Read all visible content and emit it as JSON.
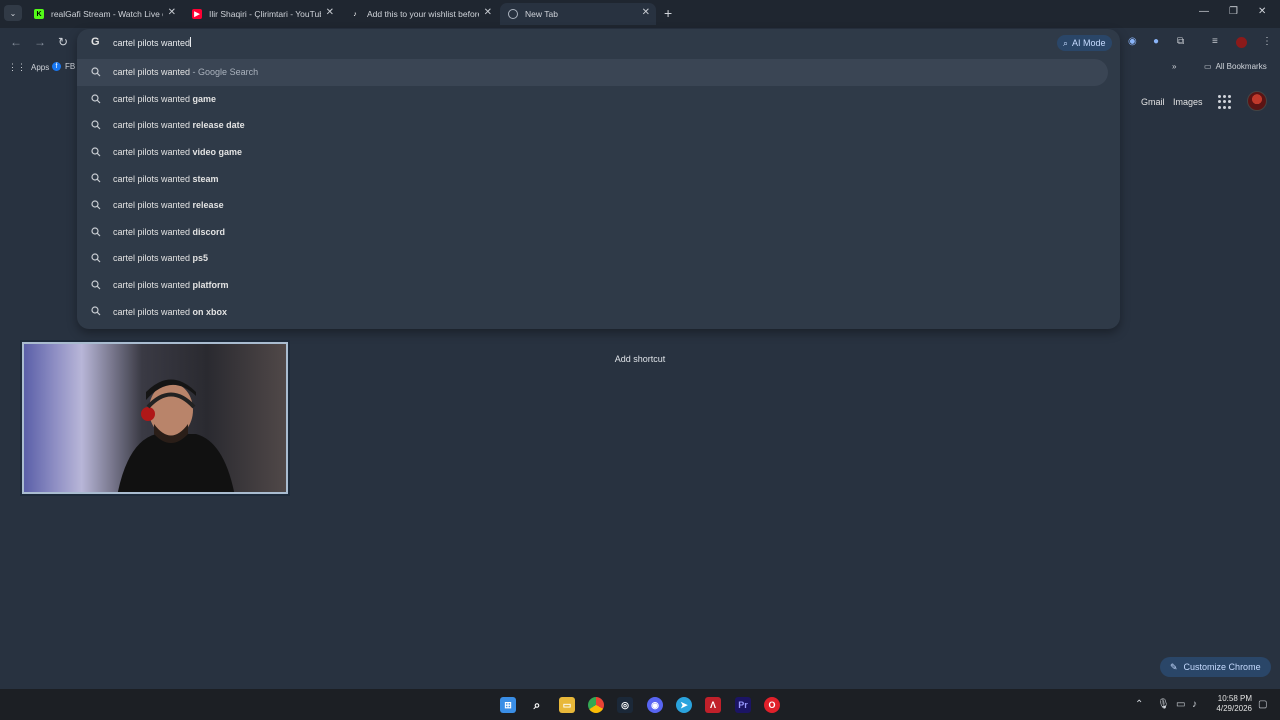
{
  "tabs": [
    {
      "title": "realGafi Stream - Watch Live on",
      "favicon": "kick-icon",
      "color": "#53fc18"
    },
    {
      "title": "Ilir Shaqiri - Çlirimtari - YouTube",
      "favicon": "youtube-icon",
      "color": "#ff0033"
    },
    {
      "title": "Add this to your wishlist before",
      "favicon": "tiktok-icon",
      "color": "#ffffff"
    },
    {
      "title": "New Tab",
      "favicon": "chrome-icon",
      "color": "#aab2bd"
    }
  ],
  "omnibox": {
    "query": "cartel pilots wanted",
    "ai_mode_label": "AI Mode",
    "suggestions": [
      {
        "base": "cartel pilots wanted",
        "suffix": " - Google Search",
        "bold": false
      },
      {
        "base": "cartel pilots wanted ",
        "suffix": "game",
        "bold": true
      },
      {
        "base": "cartel pilots wanted ",
        "suffix": "release date",
        "bold": true
      },
      {
        "base": "cartel pilots wanted ",
        "suffix": "video game",
        "bold": true
      },
      {
        "base": "cartel pilots wanted ",
        "suffix": "steam",
        "bold": true
      },
      {
        "base": "cartel pilots wanted ",
        "suffix": "release",
        "bold": true
      },
      {
        "base": "cartel pilots wanted ",
        "suffix": "discord",
        "bold": true
      },
      {
        "base": "cartel pilots wanted ",
        "suffix": "ps5",
        "bold": true
      },
      {
        "base": "cartel pilots wanted ",
        "suffix": "platform",
        "bold": true
      },
      {
        "base": "cartel pilots wanted ",
        "suffix": "on xbox",
        "bold": true
      }
    ]
  },
  "bookmarks": {
    "apps": "Apps",
    "fb": "FB",
    "all_bookmarks": "All Bookmarks"
  },
  "ntp": {
    "gmail": "Gmail",
    "images": "Images",
    "add_shortcut": "Add shortcut",
    "customize": "Customize Chrome"
  },
  "clock": {
    "time": "10:58 PM",
    "date": "4/29/2026"
  },
  "colors": {
    "background": "#283240",
    "accent": "#c6dbff"
  }
}
